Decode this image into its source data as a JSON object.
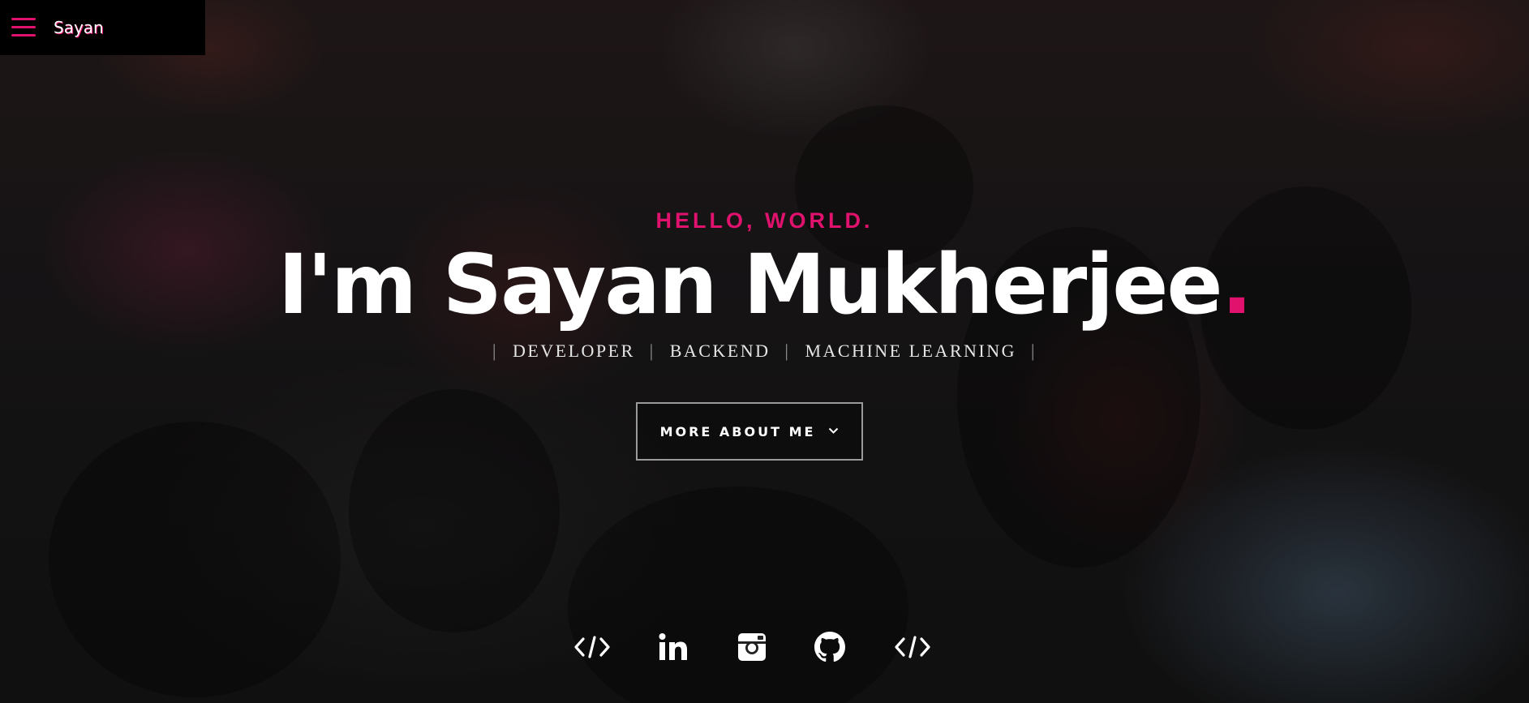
{
  "nav": {
    "brand": "Sayan",
    "menu_icon": "hamburger-menu-icon"
  },
  "hero": {
    "greeting": "HELLO, WORLD.",
    "heading": "I'm Sayan Mukherjee",
    "heading_dot": ".",
    "roles": [
      "DEVELOPER",
      "BACKEND",
      "MACHINE LEARNING"
    ],
    "role_separator": "|",
    "cta_label": "MORE ABOUT ME",
    "cta_icon": "chevron-down-icon"
  },
  "socials": [
    {
      "icon": "code-icon"
    },
    {
      "icon": "linkedin-icon"
    },
    {
      "icon": "instagram-icon"
    },
    {
      "icon": "github-icon"
    },
    {
      "icon": "code-icon"
    }
  ],
  "colors": {
    "accent": "#e0126e",
    "text": "#ffffff",
    "nav_bg": "#000000"
  }
}
